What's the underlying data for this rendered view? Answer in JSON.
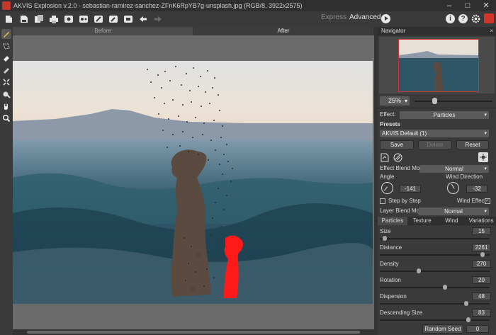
{
  "window": {
    "title": "AKVIS Explosion v.2.0 - sebastian-ramirez-sanchez-ZFnK6RpYB7g-unsplash.jpg (RGB/8, 3922x2575)",
    "controls": [
      "minimize-icon",
      "maximize-icon",
      "close-icon"
    ]
  },
  "toolbar": {
    "icons": [
      "open-icon",
      "save-icon",
      "batch-icon",
      "print-icon",
      "share-icon",
      "export-icon",
      "settings-icon",
      "brush-icon",
      "eraser-icon",
      "undo-icon",
      "redo-icon"
    ],
    "express_label": "Express",
    "advanced_label": "Advanced",
    "right_icons": [
      "info-icon",
      "help-icon",
      "preferences-icon",
      "gift-icon"
    ],
    "info_glyph": "i",
    "help_glyph": "?"
  },
  "tools": [
    "selection-brush-icon",
    "lasso-icon",
    "eraser-icon",
    "guide-icon",
    "crop-icon",
    "effect-brush-icon",
    "hand-icon",
    "zoom-icon"
  ],
  "view_tabs": {
    "before": "Before",
    "after": "After"
  },
  "navigator": {
    "title": "Navigator",
    "close": "×",
    "zoom": "25%"
  },
  "settings": {
    "effect_label": "Effect:",
    "effect_value": "Particles",
    "presets_label": "Presets",
    "preset_value": "AKVIS Default (1)",
    "save_label": "Save",
    "delete_label": "Delete",
    "reset_label": "Reset",
    "blend_label": "Effect Blend Mode",
    "blend_value": "Normal",
    "angle_label": "Angle",
    "angle_value": "-141",
    "wind_dir_label": "Wind Direction",
    "wind_dir_value": "-32",
    "step_label": "Step by Step",
    "step_checked": false,
    "wind_effect_label": "Wind Effect",
    "wind_effect_checked": true,
    "layer_blend_label": "Layer Blend Mode",
    "layer_blend_value": "Normal"
  },
  "subtabs": [
    "Particles",
    "Texture",
    "Wind",
    "Variations"
  ],
  "sliders": [
    {
      "label": "Size",
      "value": "15",
      "fraction": 0.03
    },
    {
      "label": "Distance",
      "value": "2261",
      "fraction": 0.95
    },
    {
      "label": "Density",
      "value": "270",
      "fraction": 0.35
    },
    {
      "label": "Rotation",
      "value": "20",
      "fraction": 0.6
    },
    {
      "label": "Dispersion",
      "value": "48",
      "fraction": 0.8
    },
    {
      "label": "Descending Size",
      "value": "83",
      "fraction": 0.82
    }
  ],
  "random_seed": {
    "label": "Random Seed",
    "value": "0"
  },
  "colors": {
    "accent_red": "#d0362b",
    "panel": "#3a3a3a",
    "canvas": "#6b6b6b"
  }
}
